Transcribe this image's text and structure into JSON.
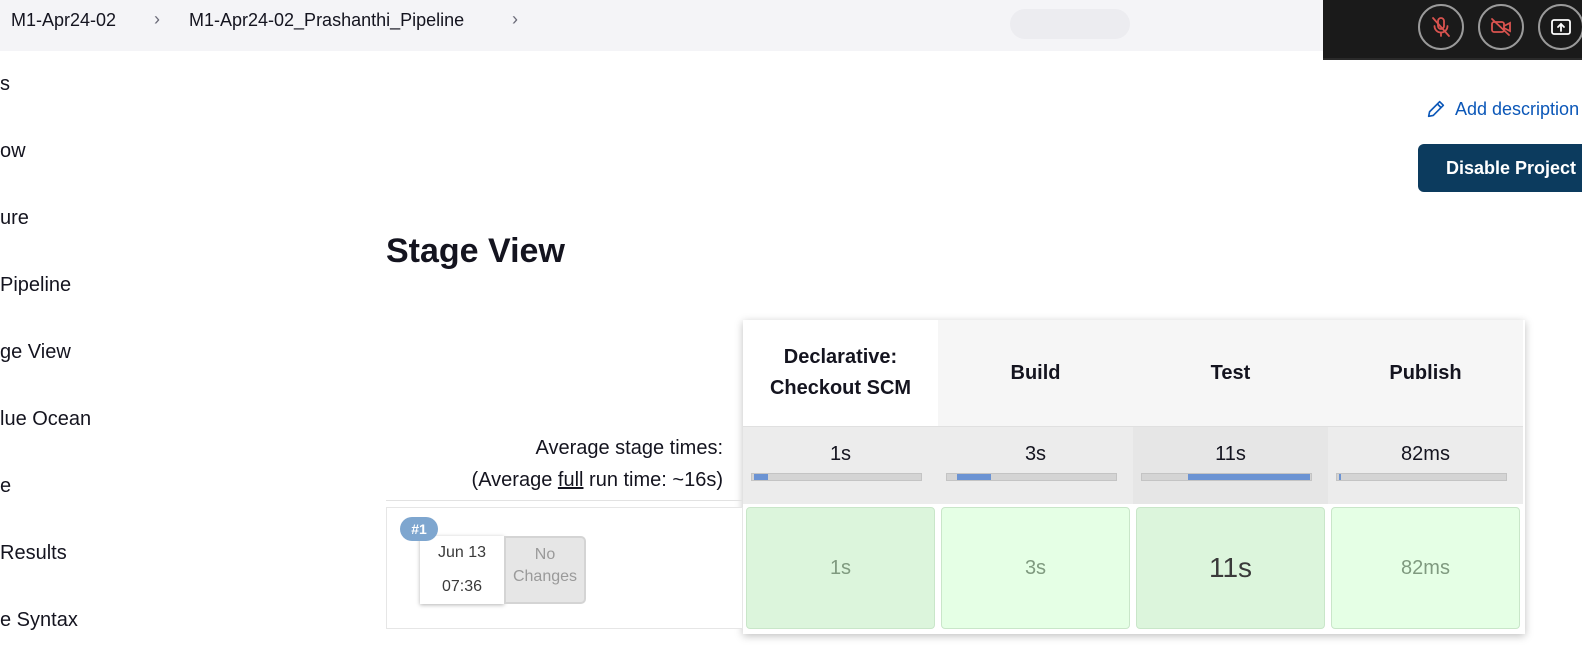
{
  "breadcrumb": {
    "items": [
      "M1-Apr24-02",
      "M1-Apr24-02_Prashanthi_Pipeline"
    ],
    "separator": ">"
  },
  "meeting_controls": {
    "icons": [
      "mic-off-icon",
      "video-off-icon",
      "share-screen-icon"
    ]
  },
  "sidebar": {
    "items": [
      "s",
      "ow",
      "ure",
      "Pipeline",
      "ge View",
      "lue Ocean",
      "e",
      "Results",
      "e Syntax"
    ]
  },
  "actions": {
    "add_description": "Add description",
    "disable_project": "Disable Project"
  },
  "stage_view": {
    "title": "Stage View",
    "avg_label_line1": "Average stage times:",
    "avg_label_prefix": "(Average ",
    "avg_label_full": "full",
    "avg_label_suffix": " run time: ~16s)",
    "stages": [
      {
        "name": "Declarative: Checkout SCM",
        "avg": "1s",
        "run": "1s",
        "bar_fraction": 0.08
      },
      {
        "name": "Build",
        "avg": "3s",
        "run": "3s",
        "bar_fraction": 0.2
      },
      {
        "name": "Test",
        "avg": "11s",
        "run": "11s",
        "bar_fraction": 0.72
      },
      {
        "name": "Publish",
        "avg": "82ms",
        "run": "82ms",
        "bar_fraction": 0.01
      }
    ],
    "run": {
      "badge": "#1",
      "date": "Jun 13",
      "time": "07:36",
      "changes": "No Changes"
    }
  },
  "colors": {
    "primary_button": "#0c3b5e",
    "link": "#0b57b8",
    "success_cell": "#dcf5dc",
    "progress_bar": "#6b93d3"
  }
}
